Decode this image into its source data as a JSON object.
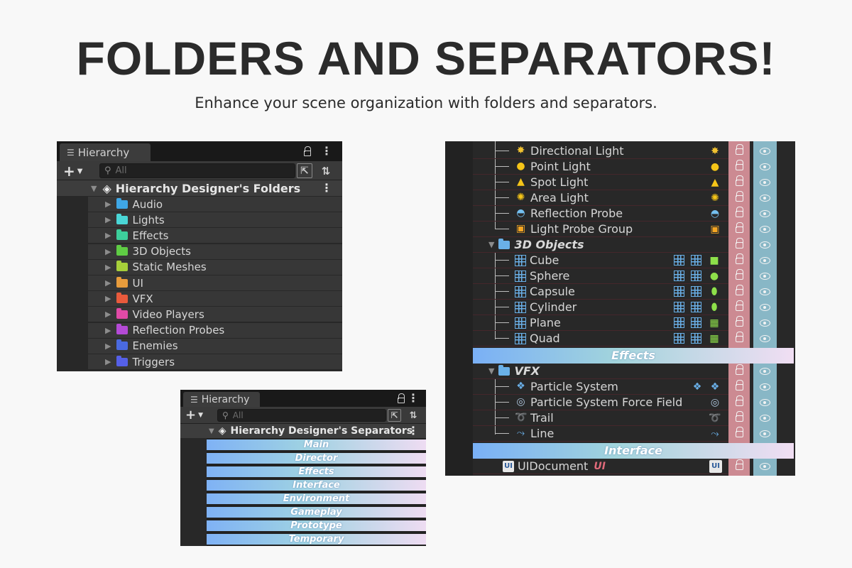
{
  "header": {
    "title": "FOLDERS AND SEPARATORS!",
    "subtitle": "Enhance your scene organization with folders and separators."
  },
  "folders_panel": {
    "tab": "Hierarchy",
    "search_placeholder": "All",
    "scene": "Hierarchy Designer's Folders",
    "folders": [
      {
        "label": "Audio",
        "color": "#3fa7e6"
      },
      {
        "label": "Lights",
        "color": "#4ad6d6"
      },
      {
        "label": "Effects",
        "color": "#3dcf9b"
      },
      {
        "label": "3D Objects",
        "color": "#5fcc44"
      },
      {
        "label": "Static Meshes",
        "color": "#a6cf3a"
      },
      {
        "label": "UI",
        "color": "#e89c3c"
      },
      {
        "label": "VFX",
        "color": "#e85a3c"
      },
      {
        "label": "Video Players",
        "color": "#e04aa6"
      },
      {
        "label": "Reflection Probes",
        "color": "#b44ad6"
      },
      {
        "label": "Enemies",
        "color": "#4a6ae0"
      },
      {
        "label": "Triggers",
        "color": "#5560e8"
      }
    ]
  },
  "separators_panel": {
    "tab": "Hierarchy",
    "search_placeholder": "All",
    "scene": "Hierarchy Designer's Separators",
    "separators": [
      "Main",
      "Director",
      "Effects",
      "Interface",
      "Environment",
      "Gameplay",
      "Prototype",
      "Temporary"
    ]
  },
  "scene_panel": {
    "lights": [
      {
        "label": "Directional Light",
        "icon": "directional-light-icon"
      },
      {
        "label": "Point Light",
        "icon": "point-light-icon"
      },
      {
        "label": "Spot Light",
        "icon": "spot-light-icon"
      },
      {
        "label": "Area Light",
        "icon": "area-light-icon"
      },
      {
        "label": "Reflection Probe",
        "icon": "reflection-probe-icon"
      },
      {
        "label": "Light Probe Group",
        "icon": "light-probe-group-icon"
      }
    ],
    "objects_folder": "3D Objects",
    "objects": [
      "Cube",
      "Sphere",
      "Capsule",
      "Cylinder",
      "Plane",
      "Quad"
    ],
    "effects_separator": "Effects",
    "vfx_folder": "VFX",
    "vfx": [
      {
        "label": "Particle System",
        "icon": "particle-system-icon"
      },
      {
        "label": "Particle System Force Field",
        "icon": "force-field-icon"
      },
      {
        "label": "Trail",
        "icon": "trail-icon"
      },
      {
        "label": "Line",
        "icon": "line-icon"
      }
    ],
    "interface_separator": "Interface",
    "ui_document": "UIDocument",
    "ui_tag": "UI"
  }
}
